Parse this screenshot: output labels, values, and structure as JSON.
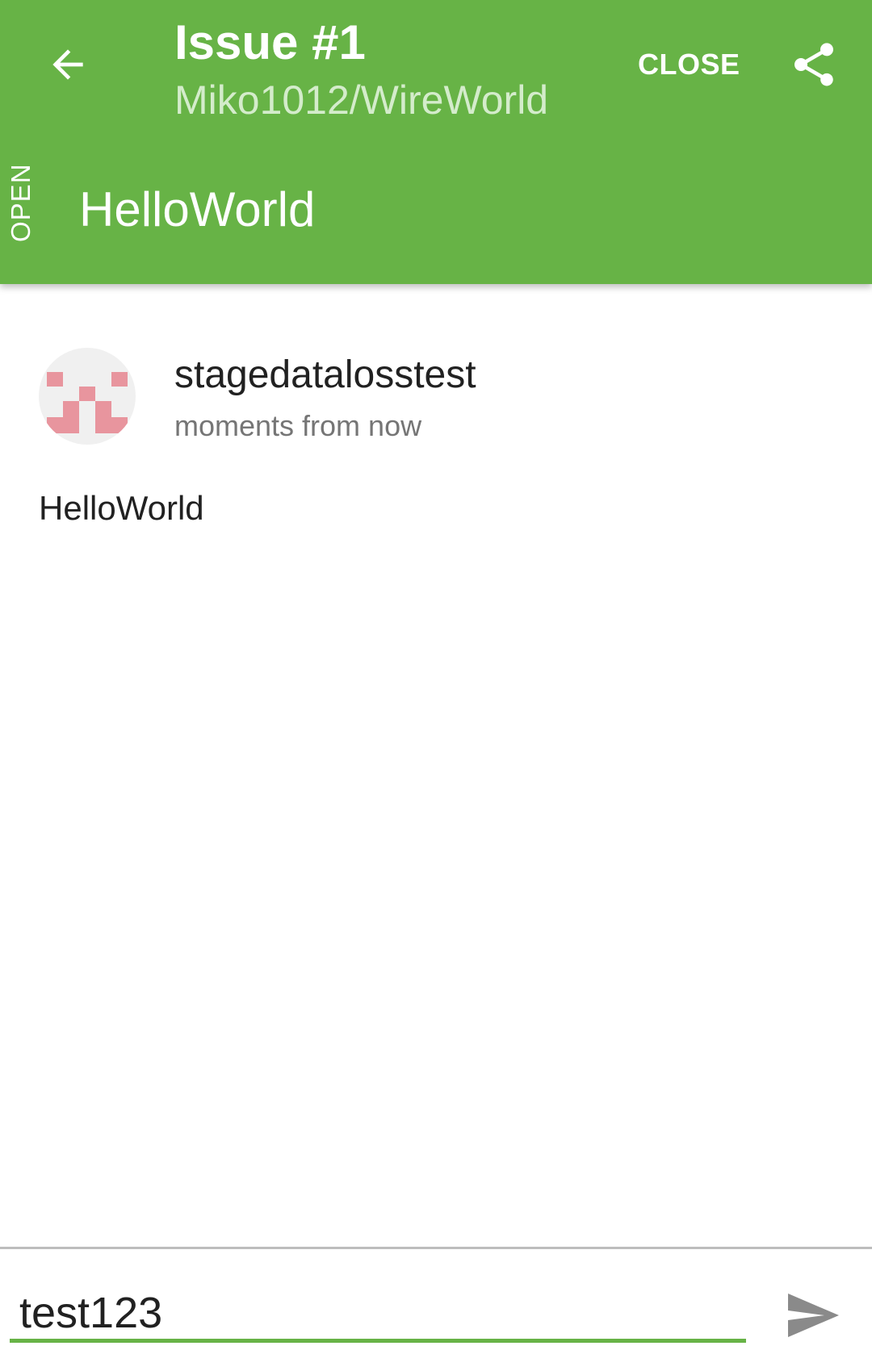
{
  "header": {
    "title": "Issue #1",
    "subtitle": "Miko1012/WireWorld",
    "close_label": "CLOSE",
    "state": "OPEN",
    "issue_title": "HelloWorld",
    "back_icon": "arrow-back-icon",
    "share_icon": "share-icon",
    "background_color": "#67B346"
  },
  "comment": {
    "author": "stagedatalosstest",
    "timestamp": "moments from now",
    "body": "HelloWorld",
    "avatar_icon": "identicon-avatar",
    "avatar_color": "#E8959E"
  },
  "composer": {
    "input_value": "test123",
    "send_icon": "send-icon",
    "accent_color": "#67B346"
  }
}
